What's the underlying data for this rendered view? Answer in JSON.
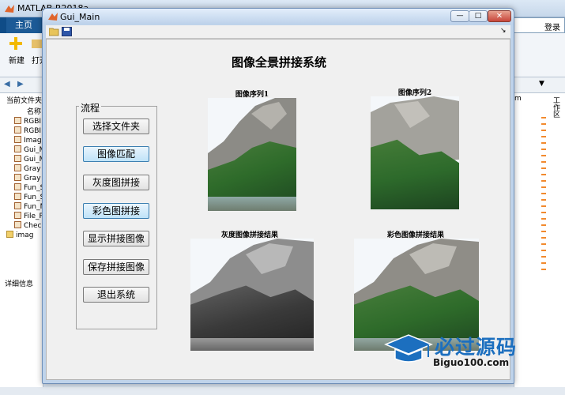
{
  "matlab": {
    "title": "MATLAB R2018a",
    "tab_home": "主页",
    "btn_new": "新建",
    "btn_open": "打开",
    "search_right": "登录",
    "current_folder": "当前文件夹",
    "name_header": "名称",
    "files": [
      "RGBI",
      "RGBI",
      "Imag",
      "Gui_M",
      "Gui_M",
      "Gray",
      "Gray",
      "Fun_S",
      "Fun_S",
      "Fun_M",
      "File_P",
      "Chec",
      "imag"
    ],
    "details": "详细信息",
    "workspace": "工作区",
    "right_tab": "m"
  },
  "gui": {
    "window_title": "Gui_Main",
    "main_title": "图像全景拼接系统",
    "panel_label": "流程",
    "buttons": [
      "选择文件夹",
      "图像匹配",
      "灰度图拼接",
      "彩色图拼接",
      "显示拼接图像",
      "保存拼接图像",
      "退出系统"
    ],
    "highlighted_buttons": [
      1,
      3
    ],
    "captions": {
      "seq1": "图像序列1",
      "seq2": "图像序列2",
      "gray": "灰度图像拼接结果",
      "color": "彩色图像拼接结果"
    }
  },
  "watermark": {
    "cn": "必过源码",
    "url": "Biguo100.com"
  },
  "colors": {
    "ribbon_blue": "#0f4c87",
    "forest_green": "#2e6b2a",
    "highlight_button": "#bfe3f8",
    "watermark_blue": "#1c6fbf"
  }
}
